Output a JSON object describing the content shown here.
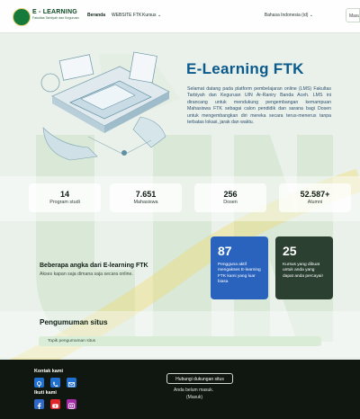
{
  "header": {
    "brand_line1": "E - LEARNING",
    "brand_line2": "Fakultas Tarbiyah dan Keguruan",
    "nav": [
      {
        "label": "Beranda"
      },
      {
        "label": "WEBSITE FTK"
      },
      {
        "label": "Kursus ⌄"
      }
    ],
    "language": "Bahasa Indonesia (id) ⌄",
    "login_label": "Masuk"
  },
  "hero": {
    "title": "E-Learning FTK",
    "description": "Selamat datang pada platform pembelajaran online (LMS) Fakultas Tarbiyah dan Keguruan UIN Ar-Raniry Banda Aceh. LMS ini dirancang untuk mendukung pengembangan kemampuan Mahasiswa FTK sebagai calon pendidik dan sarana bagi Dosen untuk mengembangkan diri mereka secara terus-menerus tanpa terbatas lokasi, jarak dan waktu."
  },
  "stats": [
    {
      "value": "14",
      "label": "Program studi"
    },
    {
      "value": "7.651",
      "label": "Mahasiswa"
    },
    {
      "value": "256",
      "label": "Dosen"
    },
    {
      "value": "52.587+",
      "label": "Alumni"
    }
  ],
  "numbers": {
    "title": "Beberapa angka dari E-learning FTK",
    "subtitle": "Akses kapan saja dimana saja secara online.",
    "cards": [
      {
        "value": "87",
        "text": "Pengguna aktif mengakses E-learning FTK kami yang luar biasa"
      },
      {
        "value": "25",
        "text": "Kursus yang dibuat untuk anda yang dapat anda percayai!"
      }
    ]
  },
  "announcements": {
    "title": "Pengumuman situs",
    "empty_text": "Topik pengumuman situs"
  },
  "footer": {
    "contact_title": "Kontak kami",
    "follow_title": "Ikuti kami",
    "support_button": "Hubungi dukungan situs",
    "login_status_line1": "Anda belum masuk.",
    "login_status_line2": "(Masuk)"
  },
  "colors": {
    "accent_blue": "#2a63bd",
    "dark_green": "#2c4032",
    "title_blue": "#0a5a8c",
    "footer_bg": "#0f1710"
  }
}
